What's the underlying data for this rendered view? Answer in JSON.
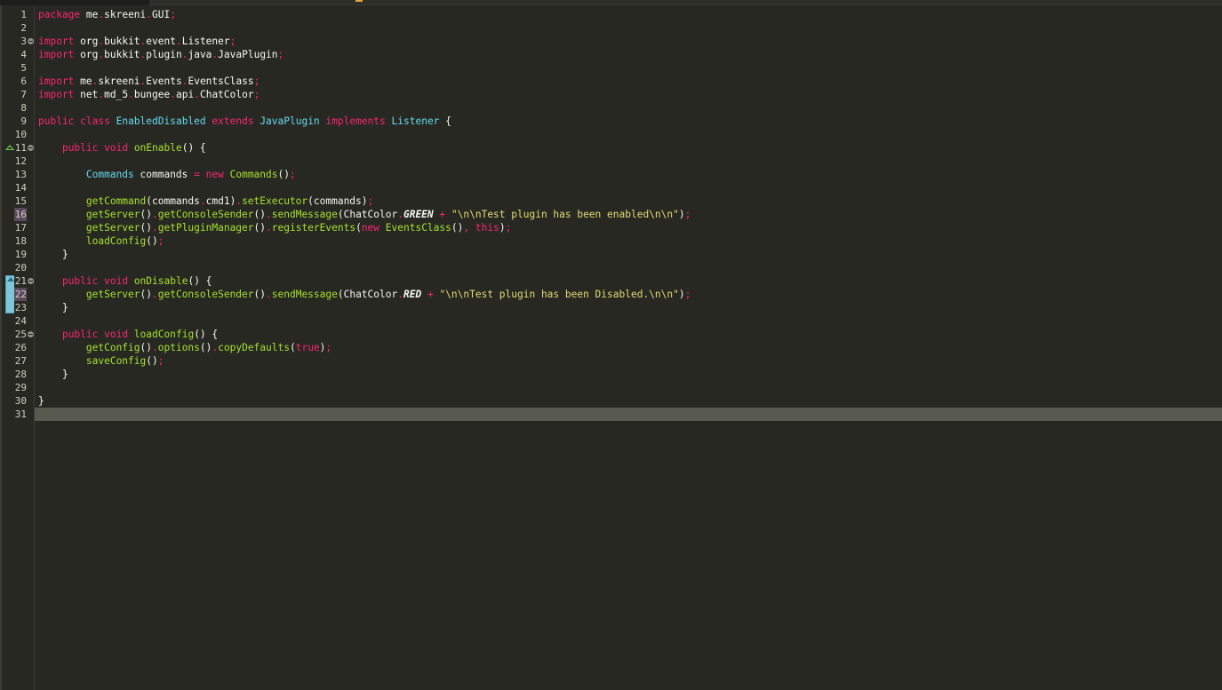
{
  "editor": {
    "current_line": 31,
    "lines": [
      {
        "n": "1",
        "tokens": [
          [
            "kw",
            "package"
          ],
          [
            "pl",
            " me"
          ],
          [
            "dot",
            "."
          ],
          [
            "pl",
            "skreeni"
          ],
          [
            "dot",
            "."
          ],
          [
            "pl",
            "GUI"
          ],
          [
            "semi",
            ";"
          ]
        ]
      },
      {
        "n": "2",
        "tokens": []
      },
      {
        "n": "3",
        "tokens": [
          [
            "kw",
            "import"
          ],
          [
            "pl",
            " org"
          ],
          [
            "dot",
            "."
          ],
          [
            "pl",
            "bukkit"
          ],
          [
            "dot",
            "."
          ],
          [
            "pl",
            "event"
          ],
          [
            "dot",
            "."
          ],
          [
            "pl",
            "Listener"
          ],
          [
            "semi",
            ";"
          ]
        ]
      },
      {
        "n": "4",
        "tokens": [
          [
            "kw",
            "import"
          ],
          [
            "pl",
            " org"
          ],
          [
            "dot",
            "."
          ],
          [
            "pl",
            "bukkit"
          ],
          [
            "dot",
            "."
          ],
          [
            "pl",
            "plugin"
          ],
          [
            "dot",
            "."
          ],
          [
            "pl",
            "java"
          ],
          [
            "dot",
            "."
          ],
          [
            "pl",
            "JavaPlugin"
          ],
          [
            "semi",
            ";"
          ]
        ]
      },
      {
        "n": "5",
        "tokens": []
      },
      {
        "n": "6",
        "tokens": [
          [
            "kw",
            "import"
          ],
          [
            "pl",
            " me"
          ],
          [
            "dot",
            "."
          ],
          [
            "pl",
            "skreeni"
          ],
          [
            "dot",
            "."
          ],
          [
            "pl",
            "Events"
          ],
          [
            "dot",
            "."
          ],
          [
            "pl",
            "EventsClass"
          ],
          [
            "semi",
            ";"
          ]
        ]
      },
      {
        "n": "7",
        "tokens": [
          [
            "kw",
            "import"
          ],
          [
            "pl",
            " net"
          ],
          [
            "dot",
            "."
          ],
          [
            "pl",
            "md_5"
          ],
          [
            "dot",
            "."
          ],
          [
            "pl",
            "bungee"
          ],
          [
            "dot",
            "."
          ],
          [
            "pl",
            "api"
          ],
          [
            "dot",
            "."
          ],
          [
            "pl",
            "ChatColor"
          ],
          [
            "semi",
            ";"
          ]
        ]
      },
      {
        "n": "8",
        "tokens": []
      },
      {
        "n": "9",
        "tokens": [
          [
            "kw",
            "public"
          ],
          [
            "pl",
            " "
          ],
          [
            "kw",
            "class"
          ],
          [
            "pl",
            " "
          ],
          [
            "ty",
            "EnabledDisabled"
          ],
          [
            "pl",
            " "
          ],
          [
            "kw",
            "extends"
          ],
          [
            "pl",
            " "
          ],
          [
            "ty",
            "JavaPlugin"
          ],
          [
            "pl",
            " "
          ],
          [
            "kw",
            "implements"
          ],
          [
            "pl",
            " "
          ],
          [
            "ty",
            "Listener"
          ],
          [
            "pl",
            " {"
          ]
        ]
      },
      {
        "n": "10",
        "tokens": []
      },
      {
        "n": "11",
        "tokens": [
          [
            "pl",
            "    "
          ],
          [
            "kw",
            "public"
          ],
          [
            "pl",
            " "
          ],
          [
            "kw",
            "void"
          ],
          [
            "pl",
            " "
          ],
          [
            "fn",
            "onEnable"
          ],
          [
            "pl",
            "() {"
          ]
        ]
      },
      {
        "n": "12",
        "tokens": []
      },
      {
        "n": "13",
        "tokens": [
          [
            "pl",
            "        "
          ],
          [
            "ty",
            "Commands"
          ],
          [
            "pl",
            " commands "
          ],
          [
            "op",
            "="
          ],
          [
            "pl",
            " "
          ],
          [
            "kw",
            "new"
          ],
          [
            "pl",
            " "
          ],
          [
            "fn",
            "Commands"
          ],
          [
            "pl",
            "()"
          ],
          [
            "semi",
            ";"
          ]
        ]
      },
      {
        "n": "14",
        "tokens": []
      },
      {
        "n": "15",
        "tokens": [
          [
            "pl",
            "        "
          ],
          [
            "fn",
            "getCommand"
          ],
          [
            "pl",
            "(commands"
          ],
          [
            "dot",
            "."
          ],
          [
            "pl",
            "cmd1)"
          ],
          [
            "dot",
            "."
          ],
          [
            "fn",
            "setExecutor"
          ],
          [
            "pl",
            "(commands)"
          ],
          [
            "semi",
            ";"
          ]
        ]
      },
      {
        "n": "16",
        "tokens": [
          [
            "pl",
            "        "
          ],
          [
            "fn",
            "getServer"
          ],
          [
            "pl",
            "()"
          ],
          [
            "dot",
            "."
          ],
          [
            "fn",
            "getConsoleSender"
          ],
          [
            "pl",
            "()"
          ],
          [
            "dot",
            "."
          ],
          [
            "fn",
            "sendMessage"
          ],
          [
            "pl",
            "(ChatColor"
          ],
          [
            "dot",
            "."
          ],
          [
            "cn",
            "GREEN"
          ],
          [
            "pl",
            " "
          ],
          [
            "op",
            "+"
          ],
          [
            "pl",
            " "
          ],
          [
            "st",
            "\"\\n\\nTest plugin has been enabled\\n\\n\""
          ],
          [
            "pl",
            ")"
          ],
          [
            "semi",
            ";"
          ]
        ]
      },
      {
        "n": "17",
        "tokens": [
          [
            "pl",
            "        "
          ],
          [
            "fn",
            "getServer"
          ],
          [
            "pl",
            "()"
          ],
          [
            "dot",
            "."
          ],
          [
            "fn",
            "getPluginManager"
          ],
          [
            "pl",
            "()"
          ],
          [
            "dot",
            "."
          ],
          [
            "fn",
            "registerEvents"
          ],
          [
            "pl",
            "("
          ],
          [
            "kw",
            "new"
          ],
          [
            "pl",
            " "
          ],
          [
            "fn",
            "EventsClass"
          ],
          [
            "pl",
            "()"
          ],
          [
            "op",
            ","
          ],
          [
            "pl",
            " "
          ],
          [
            "kw",
            "this"
          ],
          [
            "pl",
            ")"
          ],
          [
            "semi",
            ";"
          ]
        ]
      },
      {
        "n": "18",
        "tokens": [
          [
            "pl",
            "        "
          ],
          [
            "fn",
            "loadConfig"
          ],
          [
            "pl",
            "()"
          ],
          [
            "semi",
            ";"
          ]
        ]
      },
      {
        "n": "19",
        "tokens": [
          [
            "pl",
            "    }"
          ]
        ]
      },
      {
        "n": "20",
        "tokens": []
      },
      {
        "n": "21",
        "tokens": [
          [
            "pl",
            "    "
          ],
          [
            "kw",
            "public"
          ],
          [
            "pl",
            " "
          ],
          [
            "kw",
            "void"
          ],
          [
            "pl",
            " "
          ],
          [
            "fn",
            "onDisable"
          ],
          [
            "pl",
            "() {"
          ]
        ]
      },
      {
        "n": "22",
        "tokens": [
          [
            "pl",
            "        "
          ],
          [
            "fn",
            "getServer"
          ],
          [
            "pl",
            "()"
          ],
          [
            "dot",
            "."
          ],
          [
            "fn",
            "getConsoleSender"
          ],
          [
            "pl",
            "()"
          ],
          [
            "dot",
            "."
          ],
          [
            "fn",
            "sendMessage"
          ],
          [
            "pl",
            "(ChatColor"
          ],
          [
            "dot",
            "."
          ],
          [
            "cn",
            "RED"
          ],
          [
            "pl",
            " "
          ],
          [
            "op",
            "+"
          ],
          [
            "pl",
            " "
          ],
          [
            "st",
            "\"\\n\\nTest plugin has been Disabled.\\n\\n\""
          ],
          [
            "pl",
            ")"
          ],
          [
            "semi",
            ";"
          ]
        ]
      },
      {
        "n": "23",
        "tokens": [
          [
            "pl",
            "    }"
          ]
        ]
      },
      {
        "n": "24",
        "tokens": []
      },
      {
        "n": "25",
        "tokens": [
          [
            "pl",
            "    "
          ],
          [
            "kw",
            "public"
          ],
          [
            "pl",
            " "
          ],
          [
            "kw",
            "void"
          ],
          [
            "pl",
            " "
          ],
          [
            "fn",
            "loadConfig"
          ],
          [
            "pl",
            "() {"
          ]
        ]
      },
      {
        "n": "26",
        "tokens": [
          [
            "pl",
            "        "
          ],
          [
            "fn",
            "getConfig"
          ],
          [
            "pl",
            "()"
          ],
          [
            "dot",
            "."
          ],
          [
            "fn",
            "options"
          ],
          [
            "pl",
            "()"
          ],
          [
            "dot",
            "."
          ],
          [
            "fn",
            "copyDefaults"
          ],
          [
            "pl",
            "("
          ],
          [
            "bo",
            "true"
          ],
          [
            "pl",
            ")"
          ],
          [
            "semi",
            ";"
          ]
        ]
      },
      {
        "n": "27",
        "tokens": [
          [
            "pl",
            "        "
          ],
          [
            "fn",
            "saveConfig"
          ],
          [
            "pl",
            "()"
          ],
          [
            "semi",
            ";"
          ]
        ]
      },
      {
        "n": "28",
        "tokens": [
          [
            "pl",
            "    }"
          ]
        ]
      },
      {
        "n": "29",
        "tokens": []
      },
      {
        "n": "30",
        "tokens": [
          [
            "pl",
            "}"
          ]
        ]
      },
      {
        "n": "31",
        "tokens": []
      }
    ],
    "fold_lines": [
      3,
      11,
      21,
      25
    ],
    "marked_line_numbers": [
      16,
      22
    ],
    "override_lines": [
      11,
      21
    ],
    "colors": {
      "background": "#272822",
      "keyword": "#f92672",
      "type": "#66d9ef",
      "function": "#a6e22e",
      "string": "#e6db74",
      "plain": "#f8f8f2",
      "current_line": "#595a4f"
    }
  }
}
